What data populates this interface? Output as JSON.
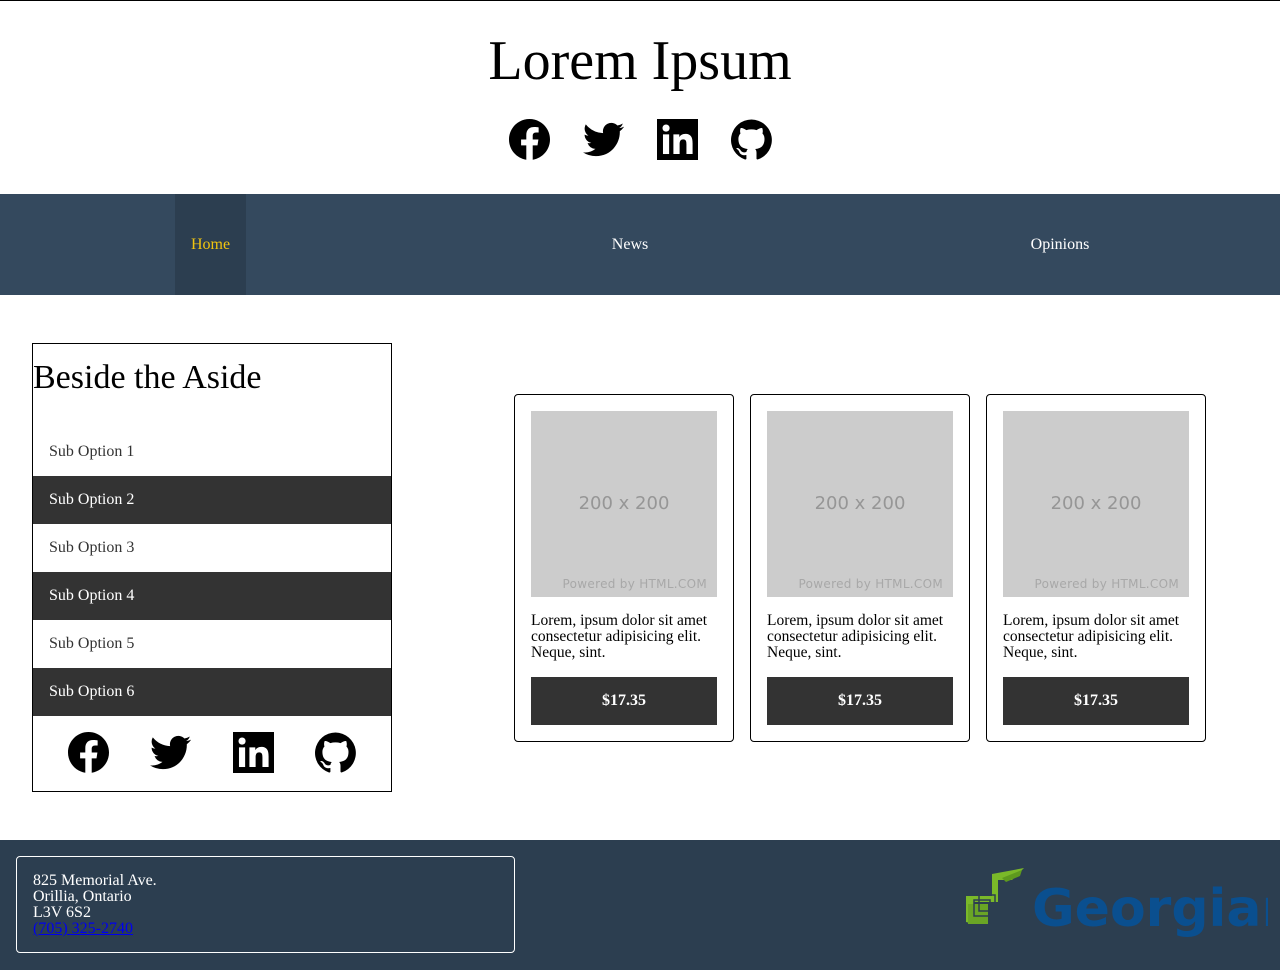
{
  "header": {
    "title": "Lorem Ipsum",
    "social": [
      "facebook-icon",
      "twitter-icon",
      "linkedin-icon",
      "github-icon"
    ]
  },
  "nav": {
    "items": [
      {
        "label": "Home",
        "active": true
      },
      {
        "label": "News",
        "active": false
      },
      {
        "label": "Opinions",
        "active": false
      }
    ]
  },
  "aside": {
    "title": "Beside the Aside",
    "options": [
      {
        "label": "Sub Option 1"
      },
      {
        "label": "Sub Option 2"
      },
      {
        "label": "Sub Option 3"
      },
      {
        "label": "Sub Option 4"
      },
      {
        "label": "Sub Option 5"
      },
      {
        "label": "Sub Option 6"
      }
    ],
    "social": [
      "facebook-icon",
      "twitter-icon",
      "linkedin-icon",
      "github-icon"
    ]
  },
  "cards": [
    {
      "image_dims": "200 x 200",
      "image_credit": "Powered by HTML.COM",
      "text": "Lorem, ipsum dolor sit amet consectetur adipisicing elit. Neque, sint.",
      "price": "$17.35"
    },
    {
      "image_dims": "200 x 200",
      "image_credit": "Powered by HTML.COM",
      "text": "Lorem, ipsum dolor sit amet consectetur adipisicing elit. Neque, sint.",
      "price": "$17.35"
    },
    {
      "image_dims": "200 x 200",
      "image_credit": "Powered by HTML.COM",
      "text": "Lorem, ipsum dolor sit amet consectetur adipisicing elit. Neque, sint.",
      "price": "$17.35"
    }
  ],
  "footer": {
    "address_line1": "825 Memorial Ave.",
    "address_line2": "Orillia, Ontario",
    "address_line3": "L3V 6S2",
    "phone": "(705) 325-2740",
    "logo_text": "Georgian"
  },
  "colors": {
    "nav_bg": "#34495e",
    "nav_active_bg": "#2c3e50",
    "nav_active_text": "#f1c40f",
    "footer_bg": "#2c3e50",
    "dark_item": "#333333",
    "logo_green": "#7ab929",
    "logo_blue": "#0a4f8f"
  }
}
